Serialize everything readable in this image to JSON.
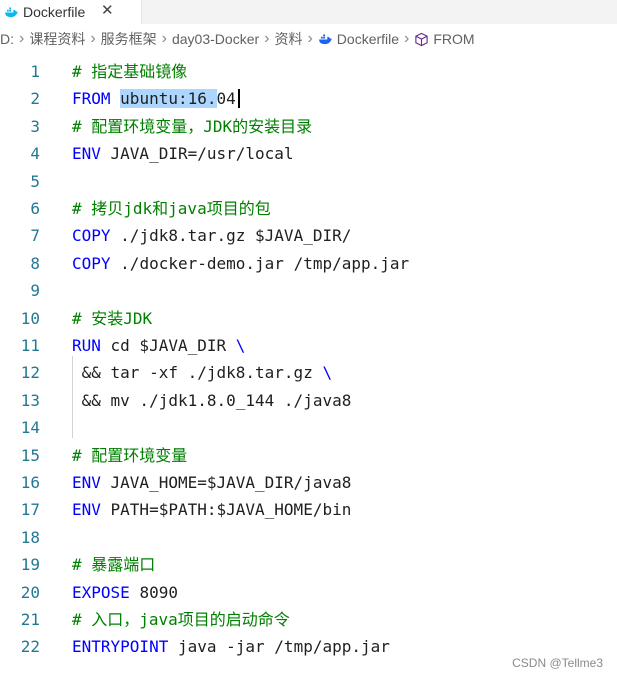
{
  "tab": {
    "label": "Dockerfile",
    "close": "✕"
  },
  "breadcrumb": [
    "D:",
    "课程资料",
    "服务框架",
    "day03-Docker",
    "资料",
    "Dockerfile",
    "FROM"
  ],
  "lines": [
    {
      "num": "1",
      "parts": [
        {
          "t": "# 指定基础镜像",
          "c": "comment"
        }
      ]
    },
    {
      "num": "2",
      "parts": [
        {
          "t": "FROM ",
          "c": "kw"
        },
        {
          "t": "ubuntu:16.",
          "c": "txt sel"
        },
        {
          "t": "04",
          "c": "txt"
        }
      ]
    },
    {
      "num": "3",
      "parts": [
        {
          "t": "# 配置环境变量，JDK的安装目录",
          "c": "comment"
        }
      ]
    },
    {
      "num": "4",
      "parts": [
        {
          "t": "ENV ",
          "c": "kw"
        },
        {
          "t": "JAVA_DIR=/usr/local",
          "c": "txt"
        }
      ]
    },
    {
      "num": "5",
      "parts": []
    },
    {
      "num": "6",
      "parts": [
        {
          "t": "# 拷贝jdk和java项目的包",
          "c": "comment"
        }
      ]
    },
    {
      "num": "7",
      "parts": [
        {
          "t": "COPY ",
          "c": "kw"
        },
        {
          "t": "./jdk8.tar.gz $JAVA_DIR/",
          "c": "txt"
        }
      ]
    },
    {
      "num": "8",
      "parts": [
        {
          "t": "COPY ",
          "c": "kw"
        },
        {
          "t": "./docker-demo.jar /tmp/app.jar",
          "c": "txt"
        }
      ]
    },
    {
      "num": "9",
      "parts": []
    },
    {
      "num": "10",
      "parts": [
        {
          "t": "# 安装JDK",
          "c": "comment"
        }
      ]
    },
    {
      "num": "11",
      "parts": [
        {
          "t": "RUN ",
          "c": "kw"
        },
        {
          "t": "cd $JAVA_DIR ",
          "c": "txt"
        },
        {
          "t": "\\",
          "c": "kw"
        }
      ]
    },
    {
      "num": "12",
      "parts": [
        {
          "t": " && tar -xf ./jdk8.tar.gz ",
          "c": "txt"
        },
        {
          "t": "\\",
          "c": "kw"
        }
      ]
    },
    {
      "num": "13",
      "parts": [
        {
          "t": " && mv ./jdk1.8.0_144 ./java8",
          "c": "txt"
        }
      ]
    },
    {
      "num": "14",
      "parts": []
    },
    {
      "num": "15",
      "parts": [
        {
          "t": "# 配置环境变量",
          "c": "comment"
        }
      ]
    },
    {
      "num": "16",
      "parts": [
        {
          "t": "ENV ",
          "c": "kw"
        },
        {
          "t": "JAVA_HOME=$JAVA_DIR/java8",
          "c": "txt"
        }
      ]
    },
    {
      "num": "17",
      "parts": [
        {
          "t": "ENV ",
          "c": "kw"
        },
        {
          "t": "PATH=$PATH:$JAVA_HOME/bin",
          "c": "txt"
        }
      ]
    },
    {
      "num": "18",
      "parts": []
    },
    {
      "num": "19",
      "parts": [
        {
          "t": "# 暴露端口",
          "c": "comment"
        }
      ]
    },
    {
      "num": "20",
      "parts": [
        {
          "t": "EXPOSE ",
          "c": "kw"
        },
        {
          "t": "8090",
          "c": "txt"
        }
      ]
    },
    {
      "num": "21",
      "parts": [
        {
          "t": "# 入口，java项目的启动命令",
          "c": "comment"
        }
      ]
    },
    {
      "num": "22",
      "parts": [
        {
          "t": "ENTRYPOINT ",
          "c": "kw"
        },
        {
          "t": "java -jar /tmp/app.jar",
          "c": "txt"
        }
      ]
    }
  ],
  "watermark": "CSDN @Tellme3",
  "colors": {
    "keyword": "#0000ff",
    "comment": "#008000",
    "line_number": "#237893",
    "selection": "#add6ff"
  }
}
